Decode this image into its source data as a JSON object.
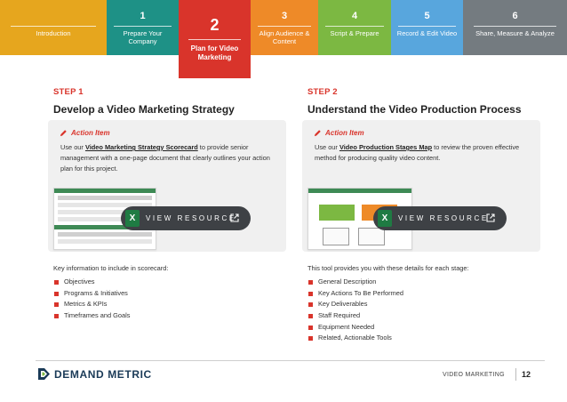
{
  "nav": {
    "tabs": [
      {
        "num": "",
        "label": "Introduction",
        "color": "#e6a61e"
      },
      {
        "num": "1",
        "label": "Prepare Your Company",
        "color": "#1e9186"
      },
      {
        "num": "2",
        "label": "Plan for Video Marketing",
        "color": "#d9342b"
      },
      {
        "num": "3",
        "label": "Align Audience & Content",
        "color": "#ee8a28"
      },
      {
        "num": "4",
        "label": "Script & Prepare",
        "color": "#7cb842"
      },
      {
        "num": "5",
        "label": "Record & Edit Video",
        "color": "#58a6dd"
      },
      {
        "num": "6",
        "label": "Share, Measure & Analyze",
        "color": "#747b80"
      }
    ]
  },
  "steps": [
    {
      "step_label": "STEP 1",
      "title": "Develop a Video Marketing Strategy",
      "action_label": "Action Item",
      "text_pre": "Use our ",
      "link_text": "Video Marketing Strategy Scorecard",
      "text_post": " to provide senior management with a one-page document that clearly outlines your action plan for this project.",
      "button_label": "VIEW RESOURCE",
      "xl_label": "X",
      "info_heading": "Key information to include in scorecard:",
      "bullets": [
        "Objectives",
        "Programs & Initiatives",
        "Metrics & KPIs",
        "Timeframes and Goals"
      ]
    },
    {
      "step_label": "STEP 2",
      "title": "Understand the Video Production Process",
      "action_label": "Action Item",
      "text_pre": "Use our ",
      "link_text": "Video Production Stages Map",
      "text_post": " to review the proven effective method for producing quality video content.",
      "button_label": "VIEW RESOURCE",
      "xl_label": "X",
      "info_heading": "This tool provides you with these details for each stage:",
      "bullets": [
        "General Description",
        "Key Actions To Be Performed",
        "Key Deliverables",
        "Staff Required",
        "Equipment Needed",
        "Related, Actionable Tools"
      ]
    }
  ],
  "footer": {
    "brand": "DEMAND METRIC",
    "section": "VIDEO MARKETING",
    "page": "12"
  }
}
